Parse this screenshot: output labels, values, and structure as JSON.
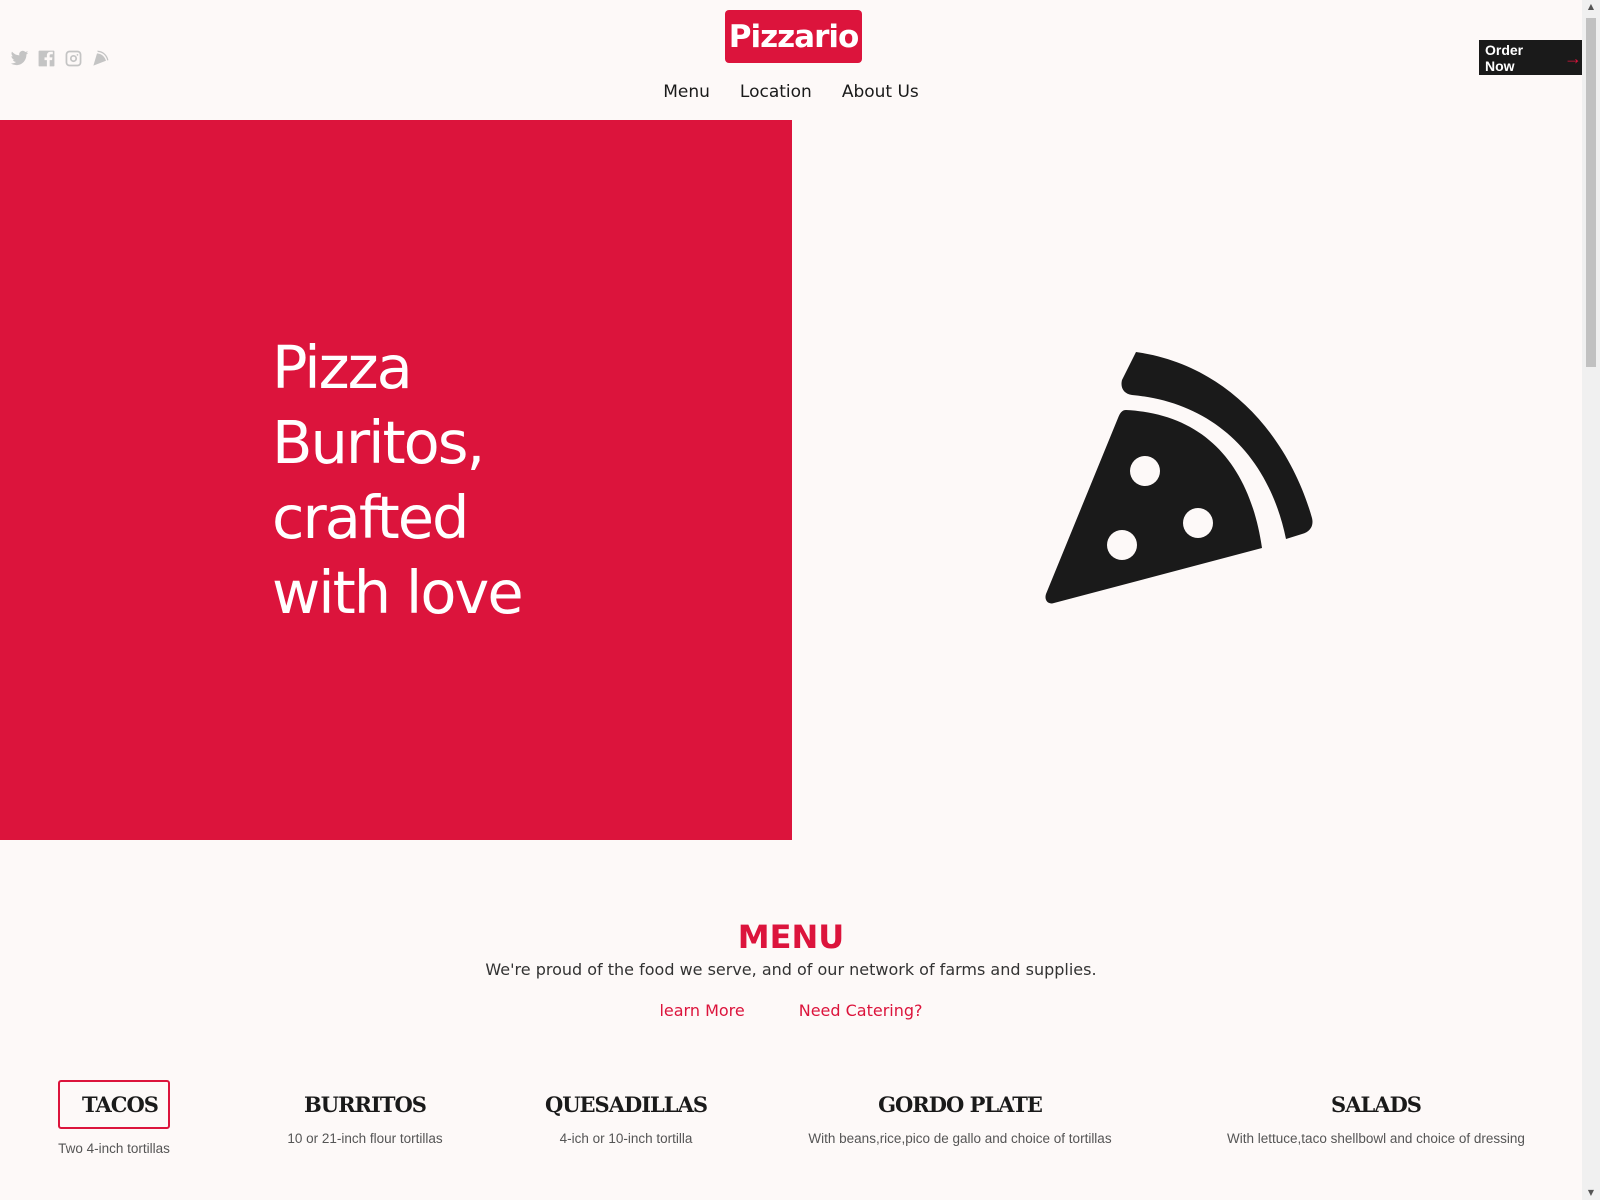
{
  "brand": {
    "logo": "Pizzario",
    "accent": "#dc143c",
    "dark": "#1a1a1a"
  },
  "social": [
    "twitter-icon",
    "facebook-icon",
    "instagram-icon",
    "pizza-slice-icon"
  ],
  "nav": {
    "items": [
      "Menu",
      "Location",
      "About Us"
    ]
  },
  "order_button": {
    "label": "Order Now",
    "arrow": "→"
  },
  "hero": {
    "lines": [
      "Pizza",
      "Buritos,",
      "crafted",
      "with love"
    ]
  },
  "menu": {
    "title": "MENU",
    "subtitle": "We're proud of the food we serve, and of our network of farms and supplies.",
    "links": [
      "learn More",
      "Need Catering?"
    ],
    "categories": [
      {
        "name": "TACOS",
        "desc": "Two 4-inch tortillas",
        "active": true
      },
      {
        "name": "BURRITOS",
        "desc": "10 or 21-inch flour tortillas"
      },
      {
        "name": "QUESADILLAS",
        "desc": "4-ich or 10-inch tortilla"
      },
      {
        "name": "GORDO PLATE",
        "desc": "With beans,rice,pico de gallo and choice of tortillas"
      },
      {
        "name": "SALADS",
        "desc": "With lettuce,taco shellbowl and choice of dressing"
      }
    ]
  }
}
